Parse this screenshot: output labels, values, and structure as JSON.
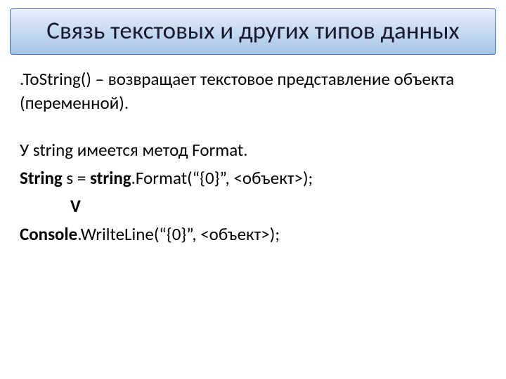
{
  "title": "Связь текстовых и других типов данных",
  "line1": ".ToString() – возвращает текстовое представление объекта (переменной).",
  "line2": "У string имеется метод Format.",
  "code1_a": "String",
  "code1_b": " s = ",
  "code1_c": "string",
  "code1_d": ".Format(“{0}”, <объект>);",
  "arrow": "V",
  "code2_a": "Console",
  "code2_b": ".WrilteLine(“{0}”, <объект>);"
}
